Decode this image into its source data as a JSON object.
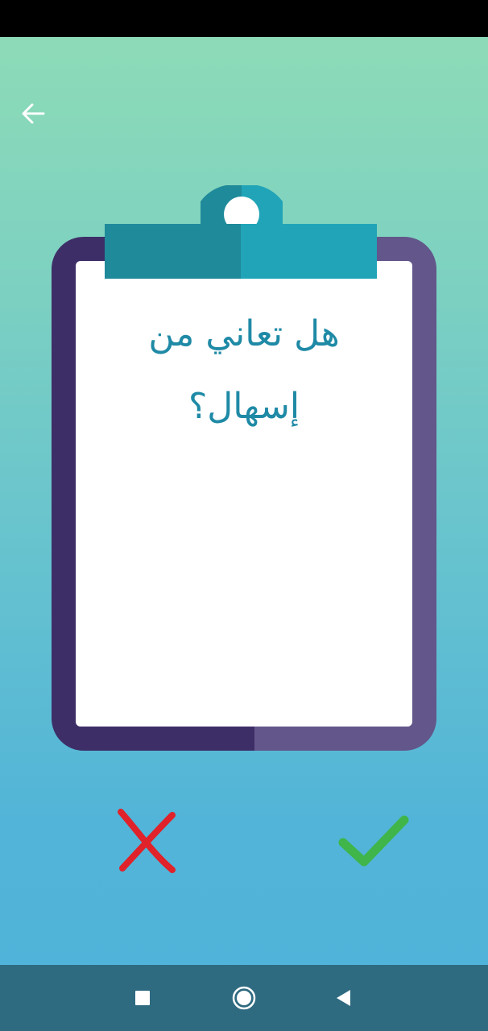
{
  "question": {
    "text": "هل تعاني من\nإسهال؟"
  },
  "colors": {
    "background_top": "#8fdcb6",
    "background_bottom": "#4fb2d9",
    "board_dark": "#3e2e67",
    "board_light": "#62568a",
    "clip_dark": "#1f8a9a",
    "clip_light": "#21a4b8",
    "question_text": "#1f8aa6",
    "no_answer": "#e0222a",
    "yes_answer": "#3fb54a",
    "nav_bar": "#2e6a80"
  },
  "icons": {
    "back": "arrow-left-icon",
    "no": "x-mark-icon",
    "yes": "check-mark-icon",
    "recents": "square-icon",
    "home": "circle-icon",
    "nav_back": "triangle-back-icon"
  }
}
